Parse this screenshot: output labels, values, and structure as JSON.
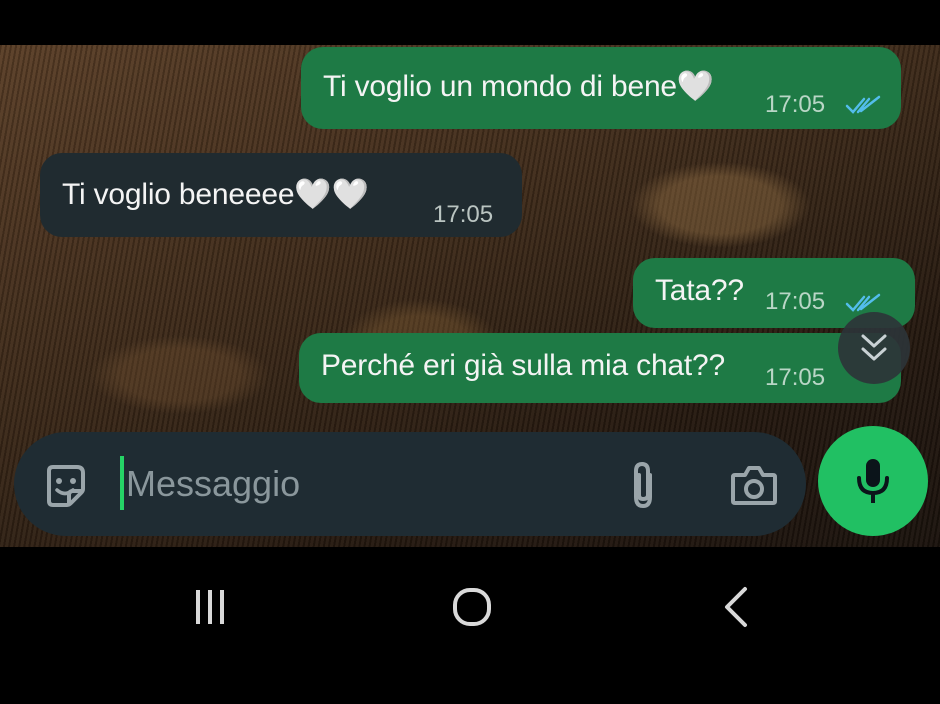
{
  "messages": [
    {
      "direction": "outgoing",
      "text": "Ti voglio un mondo di bene🤍",
      "time": "17:05",
      "status": "read"
    },
    {
      "direction": "incoming",
      "text": "Ti voglio beneeee🤍🤍",
      "time": "17:05"
    },
    {
      "direction": "outgoing",
      "text": "Tata??",
      "time": "17:05",
      "status": "read"
    },
    {
      "direction": "outgoing",
      "text": "Perché eri già sulla mia chat??",
      "time": "17:05",
      "status": "read"
    }
  ],
  "composer": {
    "placeholder": "Messaggio",
    "icons": [
      "sticker-icon",
      "paperclip-icon",
      "camera-icon",
      "microphone-icon"
    ]
  },
  "scroll_button_icon": "double-chevron-down-icon",
  "navigation_bar": [
    "recent-apps-icon",
    "home-icon",
    "back-icon"
  ],
  "colors": {
    "outgoing_bubble": "#1e7a45",
    "incoming_bubble": "#202b30",
    "composer_background": "#1f2c33",
    "mic_button": "#21c063",
    "read_ticks": "#53bdeb",
    "caret": "#25d366"
  }
}
